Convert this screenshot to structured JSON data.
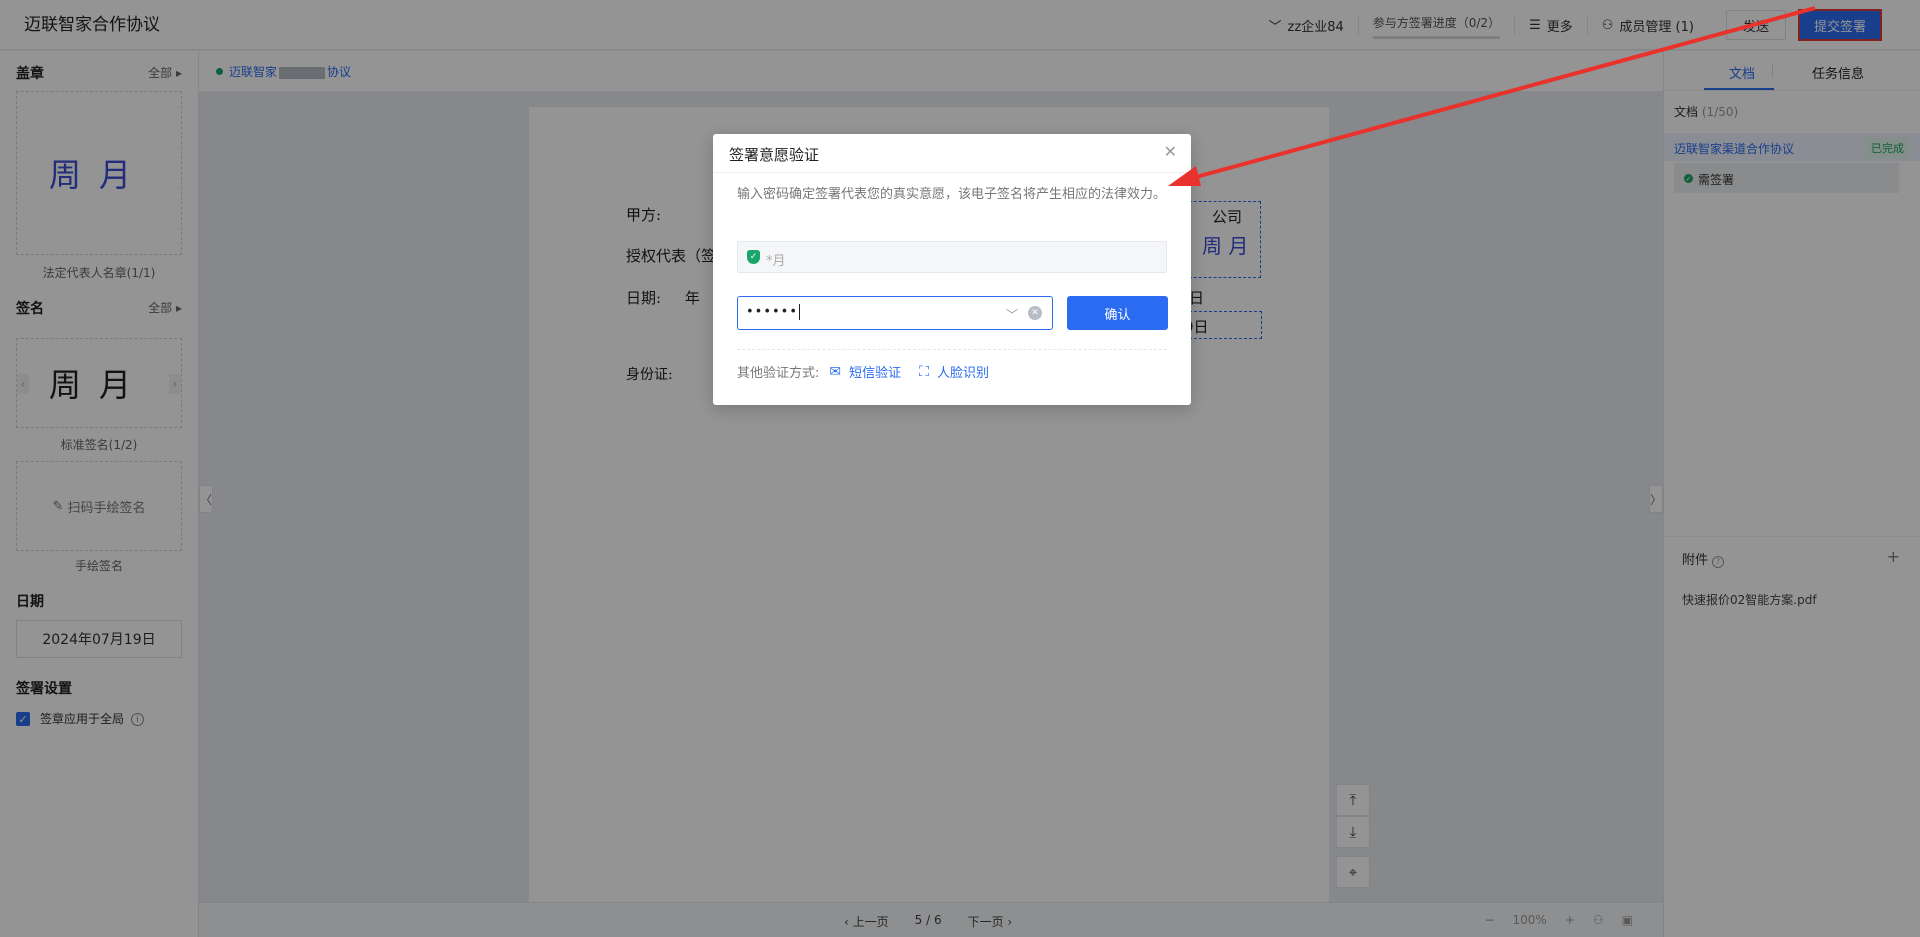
{
  "app_title": "迈联智家合作协议",
  "topbar": {
    "company": "zz企业84",
    "progress": "参与方签署进度（0/2）",
    "more": "更多",
    "members": "成员管理 (1)",
    "send": "发送",
    "submit": "提交签署"
  },
  "left": {
    "seal_title": "盖章",
    "seal_more": "全部",
    "seal_text": "周月",
    "seal_caption": "法定代表人名章(1/1)",
    "sign_title": "签名",
    "sign_more": "全部",
    "sign_text": "周月",
    "sign_caption": "标准签名(1/2)",
    "hand_sign": "扫码手绘签名",
    "hand_caption": "手绘签名",
    "date_title": "日期",
    "date_value": "2024年07月19日",
    "settings_title": "签署设置",
    "apply_all": "签章应用于全局"
  },
  "doc": {
    "crumb_left": "迈联智家",
    "crumb_right": "协议",
    "party_a": "甲方:",
    "auth_rep": "授权代表（签",
    "date_line": "日期:     年",
    "id_card": "身份证:",
    "right_company": "公司",
    "right_seal": "周 月",
    "right_day": "日",
    "right_date_box": "9日",
    "pager_prev": "上一页",
    "pager_num": "5 / 6",
    "pager_next": "下一页",
    "zoom": "100%"
  },
  "right": {
    "tab_docs": "文档",
    "tab_tasks": "任务信息",
    "docs_head": "文档",
    "docs_count": "(1/50)",
    "doc_name": "迈联智家渠道合作协议",
    "doc_status": "已完成",
    "task": "需签署",
    "attach_title": "附件",
    "attach_file": "快速报价02智能方案.pdf"
  },
  "modal": {
    "title": "签署意愿验证",
    "desc": "输入密码确定签署代表您的真实意愿，该电子签名将产生相应的法律效力。",
    "name_value": "*月",
    "password_masked": "••••••",
    "confirm": "确认",
    "other_label": "其他验证方式:",
    "sms": "短信验证",
    "face": "人脸识别"
  },
  "colors": {
    "accent": "#2a6bf2",
    "success": "#1aa56a",
    "annotation": "#e8322b"
  }
}
